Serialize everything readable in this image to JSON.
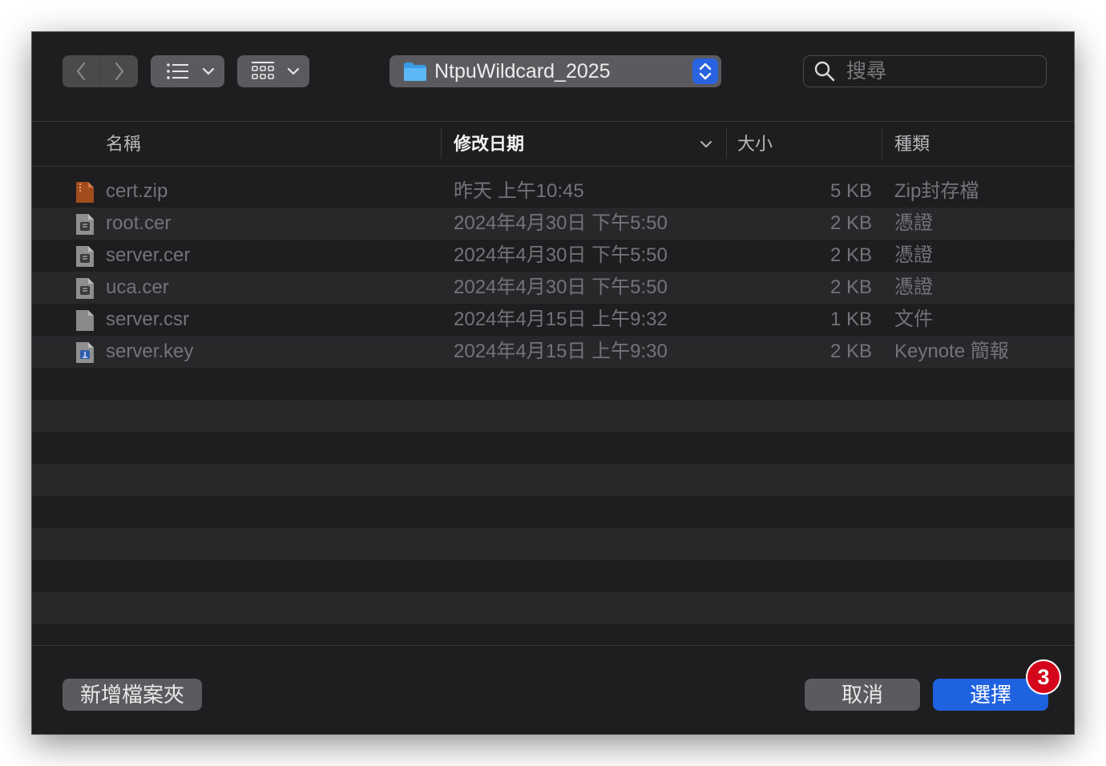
{
  "toolbar": {
    "path_label": "NtpuWildcard_2025",
    "search_placeholder": "搜尋"
  },
  "columns": {
    "name": "名稱",
    "date": "修改日期",
    "size": "大小",
    "kind": "種類"
  },
  "files": [
    {
      "name": "cert.zip",
      "date": "昨天 上午10:45",
      "size": "5 KB",
      "kind": "Zip封存檔",
      "icon": "zip-file-icon"
    },
    {
      "name": "root.cer",
      "date": "2024年4月30日 下午5:50",
      "size": "2 KB",
      "kind": "憑證",
      "icon": "certificate-file-icon"
    },
    {
      "name": "server.cer",
      "date": "2024年4月30日 下午5:50",
      "size": "2 KB",
      "kind": "憑證",
      "icon": "certificate-file-icon"
    },
    {
      "name": "uca.cer",
      "date": "2024年4月30日 下午5:50",
      "size": "2 KB",
      "kind": "憑證",
      "icon": "certificate-file-icon"
    },
    {
      "name": "server.csr",
      "date": "2024年4月15日 上午9:32",
      "size": "1 KB",
      "kind": "文件",
      "icon": "document-file-icon"
    },
    {
      "name": "server.key",
      "date": "2024年4月15日 上午9:30",
      "size": "2 KB",
      "kind": "Keynote 簡報",
      "icon": "keynote-file-icon"
    }
  ],
  "footer": {
    "new_folder": "新增檔案夾",
    "cancel": "取消",
    "choose": "選擇",
    "badge": "3"
  },
  "colors": {
    "accent": "#1f62e0",
    "badge": "#d5061b",
    "background": "#1e1e20"
  }
}
